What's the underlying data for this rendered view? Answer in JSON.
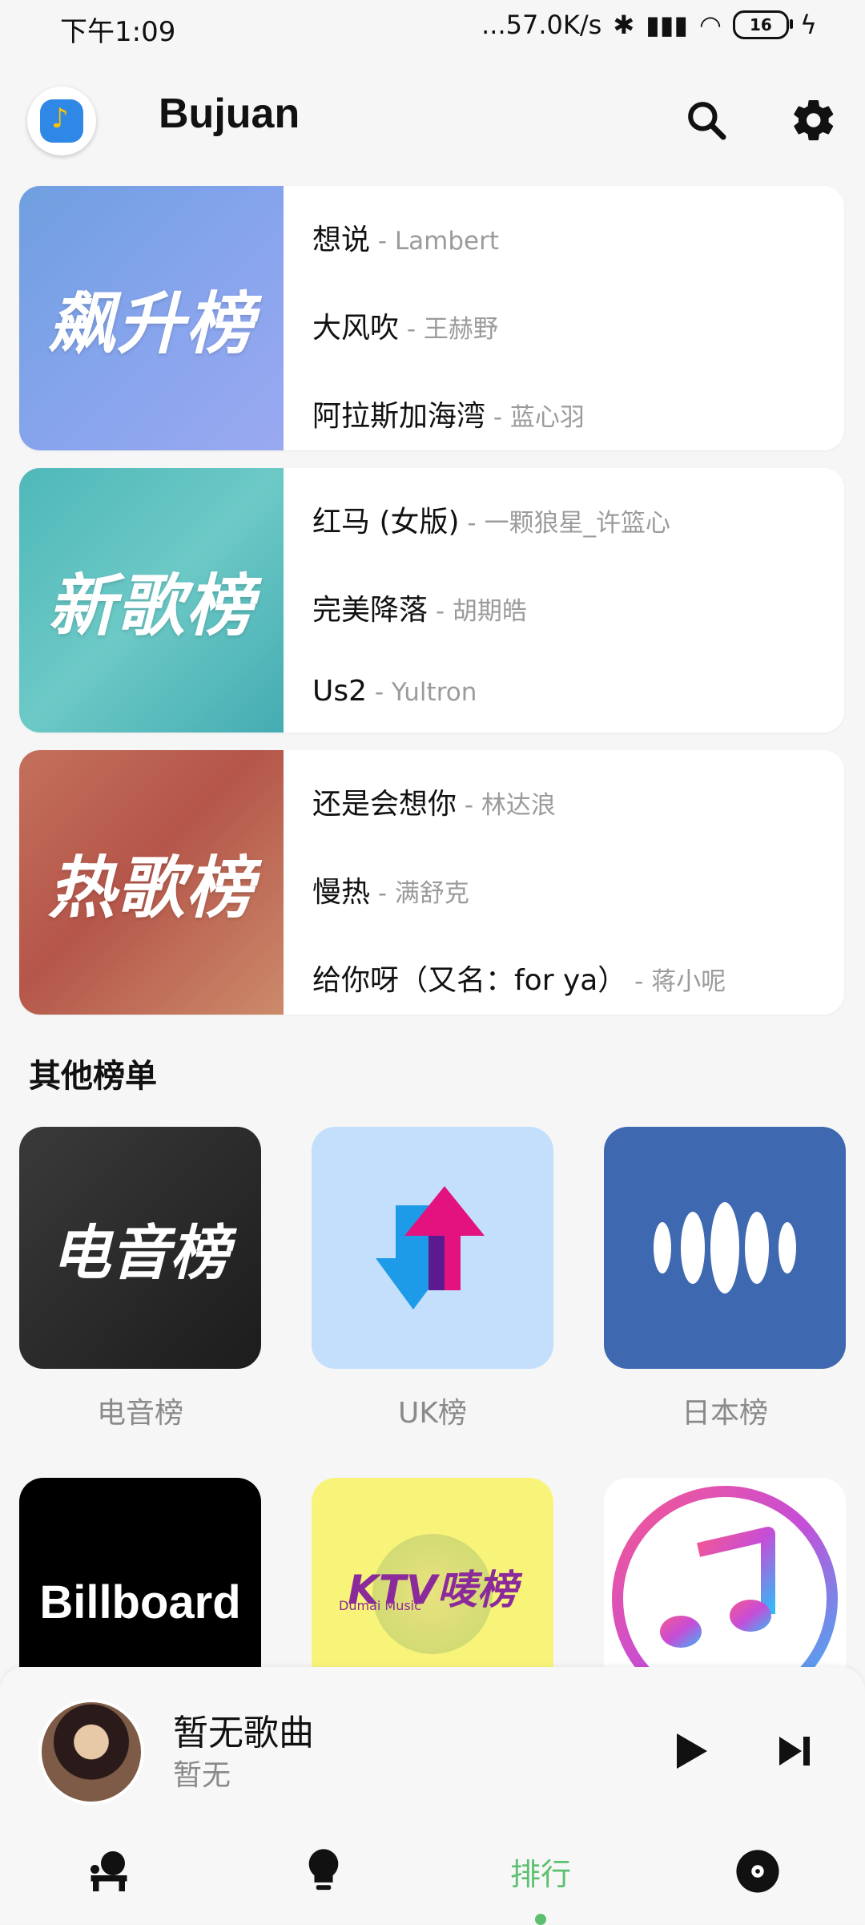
{
  "status_bar": {
    "time": "下午1:09",
    "speed": "...57.0K/s",
    "battery": "16"
  },
  "header": {
    "app_title": "Bujuan"
  },
  "rank_cards": [
    {
      "cover_title": "飙升榜",
      "tracks": [
        {
          "title": "想说",
          "artist": " - Lambert"
        },
        {
          "title": "大风吹",
          "artist": " - 王赫野"
        },
        {
          "title": "阿拉斯加海湾",
          "artist": " - 蓝心羽"
        }
      ]
    },
    {
      "cover_title": "新歌榜",
      "tracks": [
        {
          "title": "红马 (女版)",
          "artist": " - 一颗狼星_许篮心"
        },
        {
          "title": "完美降落",
          "artist": " - 胡期皓"
        },
        {
          "title": "Us2",
          "artist": " - Yultron"
        }
      ]
    },
    {
      "cover_title": "热歌榜",
      "tracks": [
        {
          "title": "还是会想你",
          "artist": " - 林达浪"
        },
        {
          "title": "慢热",
          "artist": " - 满舒克"
        },
        {
          "title": "给你呀（又名：for ya）",
          "artist": " - 蒋小呢"
        }
      ]
    }
  ],
  "other_section": {
    "title": "其他榜单",
    "tiles": [
      {
        "label": "电音榜",
        "cover_text": "电音榜"
      },
      {
        "label": "UK榜"
      },
      {
        "label": "日本榜"
      },
      {
        "cover_text": "Billboard"
      },
      {
        "cover_text": "KTV唛榜",
        "sub_text": "Dumai Music"
      },
      {
        "label": ""
      }
    ]
  },
  "player": {
    "song_title": "暂无歌曲",
    "song_artist": "暂无"
  },
  "bottom_nav": {
    "active_label": "排行"
  },
  "colors": {
    "accent": "#5cc06f",
    "card_bg": "#ffffff",
    "page_bg": "#f6f6f6"
  }
}
